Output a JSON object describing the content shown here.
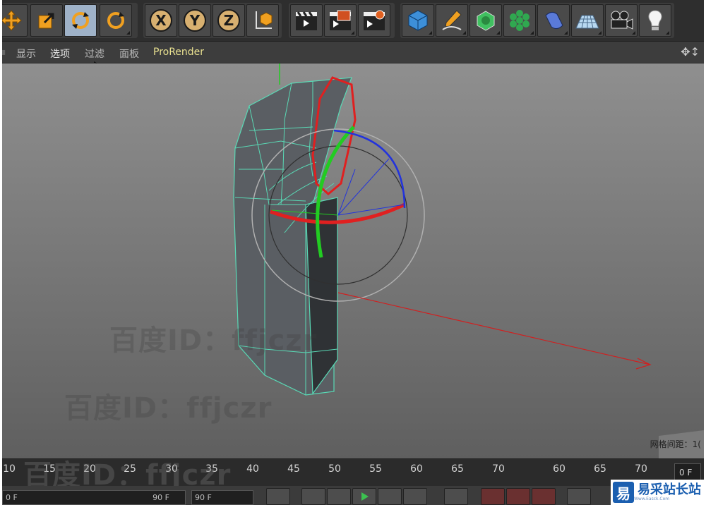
{
  "toolbar": {
    "tools": [
      {
        "name": "move-tool",
        "active": false
      },
      {
        "name": "scale-tool",
        "active": false
      },
      {
        "name": "rotate-tool",
        "active": true
      },
      {
        "name": "recent-tools",
        "active": false
      },
      {
        "name": "axis-x-lock",
        "label": "X"
      },
      {
        "name": "axis-y-lock",
        "label": "Y"
      },
      {
        "name": "axis-z-lock",
        "label": "Z"
      },
      {
        "name": "coordinate-system"
      },
      {
        "name": "render-view"
      },
      {
        "name": "render-to-picture-viewer"
      },
      {
        "name": "edit-render-settings"
      },
      {
        "name": "cube-object"
      },
      {
        "name": "pen-spline"
      },
      {
        "name": "subdivision-surface"
      },
      {
        "name": "cloner"
      },
      {
        "name": "deformer-bend"
      },
      {
        "name": "floor-environment"
      },
      {
        "name": "camera"
      },
      {
        "name": "light"
      }
    ]
  },
  "menu": {
    "items": [
      "显示",
      "选项",
      "过滤",
      "面板",
      "ProRender"
    ]
  },
  "viewport": {
    "watermarks": [
      "百度ID：ffjczr",
      "百度ID：ffjczr",
      "百度ID：ffjczr"
    ],
    "hud_text": "网格间距：1("
  },
  "timeline": {
    "ticks": [
      "10",
      "15",
      "20",
      "25",
      "30",
      "35",
      "40",
      "45",
      "50",
      "55",
      "60",
      "65",
      "70",
      "60",
      "65",
      "70"
    ],
    "current_frame": "0 F"
  },
  "transport": {
    "start_frame": "0 F",
    "end_frame": "90 F",
    "max_frame": "90 F"
  },
  "logo": {
    "mark": "易",
    "text": "易采站长站",
    "sub": "Www.Easck.Com"
  },
  "colors": {
    "toolbar_bg": "#2e2e2e",
    "active_tool": "#9fb2c8",
    "wire_edge": "#59d9b5",
    "selected_edge": "#e02020",
    "x_axis": "#e02020",
    "y_axis": "#22cc22",
    "z_axis": "#2233dd"
  }
}
